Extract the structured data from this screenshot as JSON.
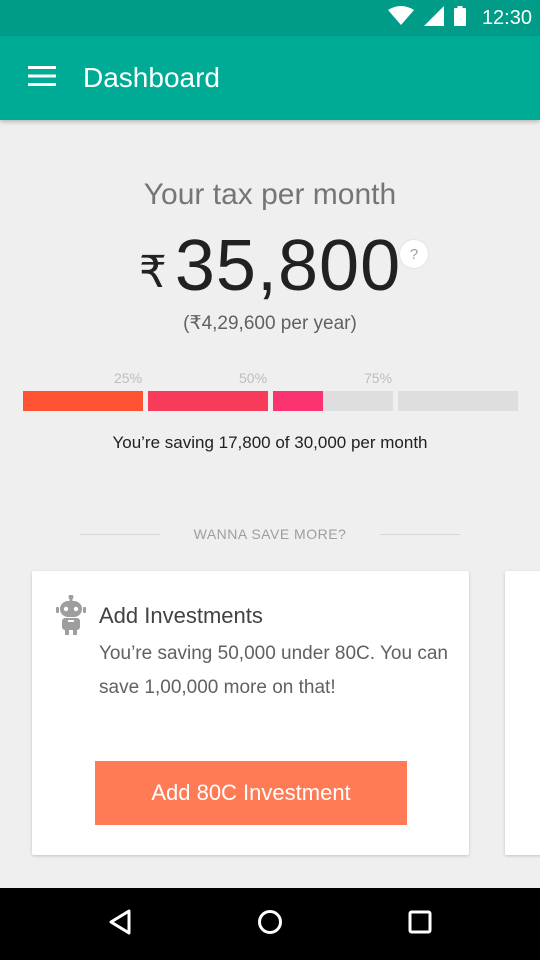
{
  "status_bar": {
    "time": "12:30",
    "icons": [
      "wifi-icon",
      "cellular-signal-icon",
      "battery-icon"
    ]
  },
  "app_bar": {
    "title": "Dashboard",
    "menu_icon": "hamburger-menu-icon",
    "color": "#00ab96"
  },
  "summary": {
    "label": "Your tax per month",
    "currency_symbol": "₹",
    "amount": "35,800",
    "help_label": "?",
    "per_year": "(₹4,29,600 per year)"
  },
  "savings_progress": {
    "tick_labels": [
      "25%",
      "50%",
      "75%"
    ],
    "segment_fill": [
      1.0,
      1.0,
      0.42,
      0.0
    ],
    "segment_colors": [
      "#ff5232",
      "#f93b5b",
      "#fb3371"
    ],
    "saved": 17800,
    "total": 30000,
    "text": "You’re saving 17,800 of 30,000 per month"
  },
  "divider": {
    "label": "WANNA SAVE MORE?"
  },
  "cards": [
    {
      "icon": "robot-icon",
      "title": "Add Investments",
      "body": "You’re saving 50,000 under 80C. You can save 1,00,000 more on that!",
      "button_label": "Add 80C Investment",
      "button_color": "#ff7b55"
    }
  ],
  "nav_bar": {
    "buttons": [
      "back-icon",
      "home-icon",
      "recents-icon"
    ]
  }
}
